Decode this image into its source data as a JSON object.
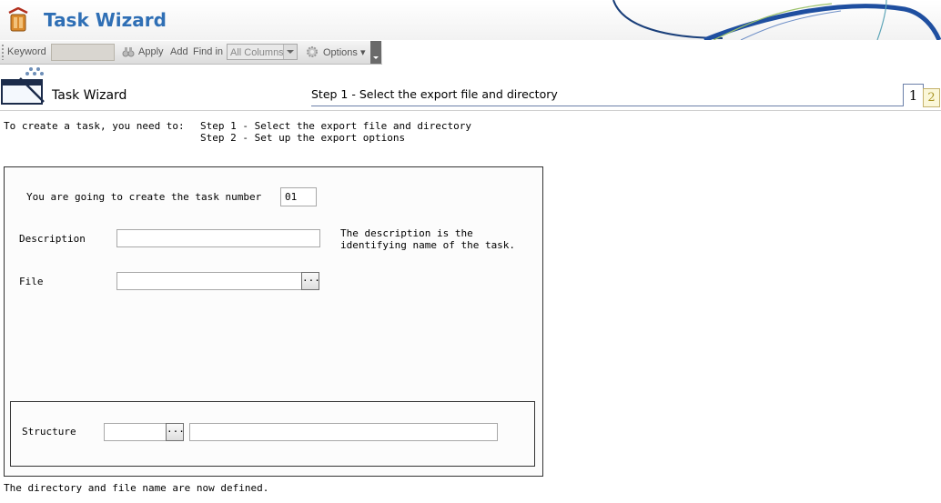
{
  "app": {
    "title": "Task Wizard",
    "brand_color": "#2f6fb5"
  },
  "toolbar": {
    "keyword_label": "Keyword",
    "keyword_value": "",
    "apply_label": "Apply",
    "add_label": "Add",
    "find_in_label": "Find in",
    "find_in_selected": "All Columns",
    "options_label": "Options"
  },
  "wizard": {
    "heading": "Task Wizard",
    "current_step_title": "Step 1 - Select the export file and directory",
    "step_numbers": [
      "1",
      "2"
    ],
    "active_step": 1
  },
  "intro": {
    "text": "To create a task, you need to:",
    "steps": [
      "Step 1 - Select the export file and directory",
      "Step 2 - Set up the export options"
    ]
  },
  "form": {
    "task_number_label": "You are going to create the task number",
    "task_number_value": "01",
    "description_label": "Description",
    "description_value": "",
    "description_hint": "The description is the identifying name of the task.",
    "file_label": "File",
    "file_value": "",
    "browse_label": "...",
    "structure_label": "Structure",
    "structure_code_value": "",
    "structure_name_value": ""
  },
  "footer": {
    "status_text": "The directory and file name are now defined."
  }
}
